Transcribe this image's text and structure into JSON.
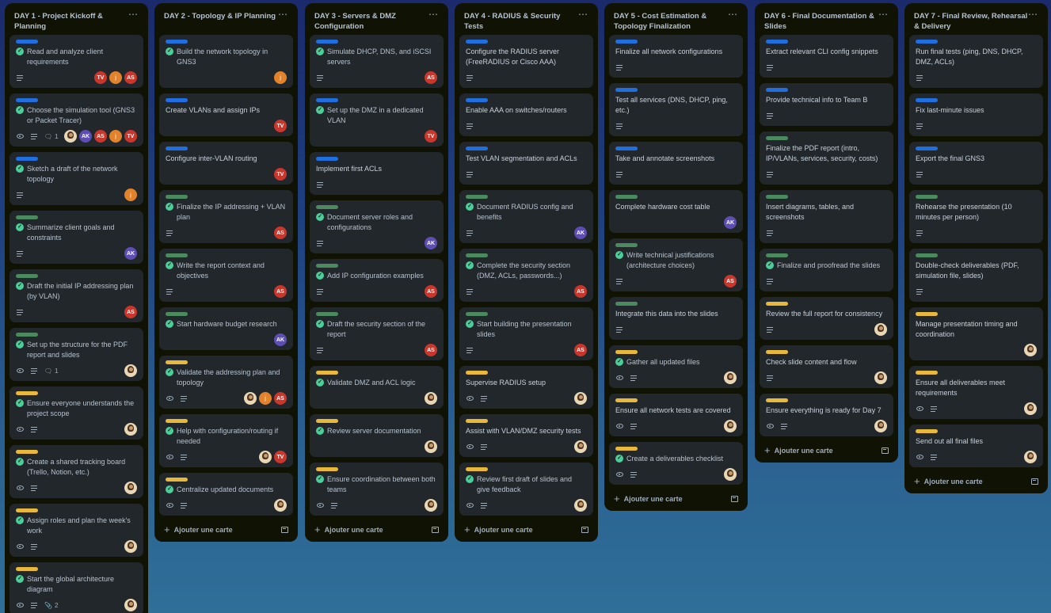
{
  "add_card_label": "Ajouter une carte",
  "lists": [
    {
      "title": "DAY 1 - Project Kickoff & Planning",
      "cards": [
        {
          "label": "blue",
          "done": true,
          "title": "Read and analyze client requirements",
          "watch": false,
          "desc": true,
          "comments": null,
          "attachments": null,
          "members": [
            "TV",
            "J",
            "AS"
          ]
        },
        {
          "label": "blue",
          "done": true,
          "title": "Choose the simulation tool (GNS3 or Packet Tracer)",
          "watch": true,
          "desc": true,
          "comments": "1",
          "attachments": null,
          "members": [
            "P",
            "AK",
            "AS",
            "J",
            "TV"
          ]
        },
        {
          "label": "blue",
          "done": true,
          "title": "Sketch a draft of the network topology",
          "watch": false,
          "desc": true,
          "comments": null,
          "attachments": null,
          "members": [
            "J"
          ]
        },
        {
          "label": "green",
          "done": true,
          "title": "Summarize client goals and constraints",
          "watch": false,
          "desc": true,
          "comments": null,
          "attachments": null,
          "members": [
            "AK"
          ]
        },
        {
          "label": "green",
          "done": true,
          "title": "Draft the initial IP addressing plan (by VLAN)",
          "watch": false,
          "desc": true,
          "comments": null,
          "attachments": null,
          "members": [
            "AS"
          ]
        },
        {
          "label": "green",
          "done": true,
          "title": "Set up the structure for the PDF report and slides",
          "watch": true,
          "desc": true,
          "comments": "1",
          "attachments": null,
          "members": [
            "P"
          ]
        },
        {
          "label": "yellow",
          "done": true,
          "title": "Ensure everyone understands the project scope",
          "watch": true,
          "desc": true,
          "comments": null,
          "attachments": null,
          "members": [
            "P"
          ]
        },
        {
          "label": "yellow",
          "done": true,
          "title": "Create a shared tracking board (Trello, Notion, etc.)",
          "watch": true,
          "desc": true,
          "comments": null,
          "attachments": null,
          "members": [
            "P"
          ]
        },
        {
          "label": "yellow",
          "done": true,
          "title": "Assign roles and plan the week's work",
          "watch": true,
          "desc": true,
          "comments": null,
          "attachments": null,
          "members": [
            "P"
          ]
        },
        {
          "label": "yellow",
          "done": true,
          "title": "Start the global architecture diagram",
          "watch": true,
          "desc": true,
          "comments": null,
          "attachments": "2",
          "members": [
            "P"
          ]
        }
      ]
    },
    {
      "title": "DAY 2 - Topology & IP Planning",
      "cards": [
        {
          "label": "blue",
          "done": true,
          "title": "Build the network topology in GNS3",
          "watch": false,
          "desc": false,
          "comments": null,
          "attachments": null,
          "members": [
            "J"
          ]
        },
        {
          "label": "blue",
          "done": false,
          "title": "Create VLANs and assign IPs",
          "watch": false,
          "desc": false,
          "comments": null,
          "attachments": null,
          "members": [
            "TV"
          ]
        },
        {
          "label": "blue",
          "done": false,
          "title": "Configure inter-VLAN routing",
          "watch": false,
          "desc": false,
          "comments": null,
          "attachments": null,
          "members": [
            "TV"
          ]
        },
        {
          "label": "green",
          "done": true,
          "title": "Finalize the IP addressing + VLAN plan",
          "watch": false,
          "desc": true,
          "comments": null,
          "attachments": null,
          "members": [
            "AS"
          ]
        },
        {
          "label": "green",
          "done": true,
          "title": "Write the report context and objectives",
          "watch": false,
          "desc": true,
          "comments": null,
          "attachments": null,
          "members": [
            "AS"
          ]
        },
        {
          "label": "green",
          "done": true,
          "title": "Start hardware budget research",
          "watch": false,
          "desc": false,
          "comments": null,
          "attachments": null,
          "members": [
            "AK"
          ]
        },
        {
          "label": "yellow",
          "done": true,
          "title": "Validate the addressing plan and topology",
          "watch": true,
          "desc": true,
          "comments": null,
          "attachments": null,
          "members": [
            "P",
            "J",
            "AS"
          ]
        },
        {
          "label": "yellow",
          "done": true,
          "title": "Help with configuration/routing if needed",
          "watch": true,
          "desc": true,
          "comments": null,
          "attachments": null,
          "members": [
            "P",
            "TV"
          ]
        },
        {
          "label": "yellow",
          "done": true,
          "title": "Centralize updated documents",
          "watch": true,
          "desc": true,
          "comments": null,
          "attachments": null,
          "members": [
            "P"
          ]
        }
      ]
    },
    {
      "title": "DAY 3 - Servers & DMZ Configuration",
      "cards": [
        {
          "label": "blue",
          "done": true,
          "title": "Simulate DHCP, DNS, and iSCSI servers",
          "watch": false,
          "desc": true,
          "comments": null,
          "attachments": null,
          "members": [
            "AS"
          ]
        },
        {
          "label": "blue",
          "done": true,
          "title": "Set up the DMZ in a dedicated VLAN",
          "watch": false,
          "desc": false,
          "comments": null,
          "attachments": null,
          "members": [
            "TV"
          ]
        },
        {
          "label": "blue",
          "done": false,
          "title": "Implement first ACLs",
          "watch": false,
          "desc": true,
          "comments": null,
          "attachments": null,
          "members": []
        },
        {
          "label": "green",
          "done": true,
          "title": "Document server roles and configurations",
          "watch": false,
          "desc": true,
          "comments": null,
          "attachments": null,
          "members": [
            "AK"
          ]
        },
        {
          "label": "green",
          "done": true,
          "title": "Add IP configuration examples",
          "watch": false,
          "desc": true,
          "comments": null,
          "attachments": null,
          "members": [
            "AS"
          ]
        },
        {
          "label": "green",
          "done": true,
          "title": "Draft the security section of the report",
          "watch": false,
          "desc": true,
          "comments": null,
          "attachments": null,
          "members": [
            "AS"
          ]
        },
        {
          "label": "yellow",
          "done": true,
          "title": "Validate DMZ and ACL logic",
          "watch": false,
          "desc": false,
          "comments": null,
          "attachments": null,
          "members": [
            "P"
          ]
        },
        {
          "label": "yellow",
          "done": true,
          "title": "Review server documentation",
          "watch": false,
          "desc": false,
          "comments": null,
          "attachments": null,
          "members": [
            "P"
          ]
        },
        {
          "label": "yellow",
          "done": true,
          "title": "Ensure coordination between both teams",
          "watch": true,
          "desc": true,
          "comments": null,
          "attachments": null,
          "members": [
            "P"
          ]
        }
      ]
    },
    {
      "title": "DAY 4 - RADIUS & Security Tests",
      "cards": [
        {
          "label": "blue",
          "done": false,
          "title": "Configure the RADIUS server (FreeRADIUS or Cisco AAA)",
          "watch": false,
          "desc": true,
          "comments": null,
          "attachments": null,
          "members": []
        },
        {
          "label": "blue",
          "done": false,
          "title": "Enable AAA on switches/routers",
          "watch": false,
          "desc": true,
          "comments": null,
          "attachments": null,
          "members": []
        },
        {
          "label": "blue",
          "done": false,
          "title": "Test VLAN segmentation and ACLs",
          "watch": false,
          "desc": true,
          "comments": null,
          "attachments": null,
          "members": []
        },
        {
          "label": "green",
          "done": true,
          "title": "Document RADIUS config and benefits",
          "watch": false,
          "desc": true,
          "comments": null,
          "attachments": null,
          "members": [
            "AK"
          ]
        },
        {
          "label": "green",
          "done": true,
          "title": "Complete the security section (DMZ, ACLs, passwords...)",
          "watch": false,
          "desc": true,
          "comments": null,
          "attachments": null,
          "members": [
            "AS"
          ]
        },
        {
          "label": "green",
          "done": true,
          "title": "Start building the presentation slides",
          "watch": false,
          "desc": true,
          "comments": null,
          "attachments": null,
          "members": [
            "AS"
          ]
        },
        {
          "label": "yellow",
          "done": false,
          "title": "Supervise RADIUS setup",
          "watch": true,
          "desc": true,
          "comments": null,
          "attachments": null,
          "members": [
            "P"
          ]
        },
        {
          "label": "yellow",
          "done": false,
          "title": "Assist with VLAN/DMZ security tests",
          "watch": true,
          "desc": true,
          "comments": null,
          "attachments": null,
          "members": [
            "P"
          ]
        },
        {
          "label": "yellow",
          "done": true,
          "title": "Review first draft of slides and give feedback",
          "watch": true,
          "desc": true,
          "comments": null,
          "attachments": null,
          "members": [
            "P"
          ]
        }
      ]
    },
    {
      "title": "DAY 5 - Cost Estimation & Topology Finalization",
      "cards": [
        {
          "label": "blue",
          "done": false,
          "title": "Finalize all network configurations",
          "watch": false,
          "desc": true,
          "comments": null,
          "attachments": null,
          "members": []
        },
        {
          "label": "blue",
          "done": false,
          "title": "Test all services (DNS, DHCP, ping, etc.)",
          "watch": false,
          "desc": true,
          "comments": null,
          "attachments": null,
          "members": []
        },
        {
          "label": "blue",
          "done": false,
          "title": "Take and annotate screenshots",
          "watch": false,
          "desc": true,
          "comments": null,
          "attachments": null,
          "members": []
        },
        {
          "label": "green",
          "done": false,
          "title": "Complete hardware cost table",
          "watch": false,
          "desc": false,
          "comments": null,
          "attachments": null,
          "members": [
            "AK"
          ]
        },
        {
          "label": "green",
          "done": true,
          "title": "Write technical justifications (architecture choices)",
          "watch": false,
          "desc": true,
          "comments": null,
          "attachments": null,
          "members": [
            "AS"
          ]
        },
        {
          "label": "green",
          "done": false,
          "title": "Integrate this data into the slides",
          "watch": false,
          "desc": true,
          "comments": null,
          "attachments": null,
          "members": []
        },
        {
          "label": "yellow",
          "done": true,
          "title": "Gather all updated files",
          "watch": true,
          "desc": true,
          "comments": null,
          "attachments": null,
          "members": [
            "P"
          ]
        },
        {
          "label": "yellow",
          "done": false,
          "title": "Ensure all network tests are covered",
          "watch": true,
          "desc": true,
          "comments": null,
          "attachments": null,
          "members": [
            "P"
          ]
        },
        {
          "label": "yellow",
          "done": true,
          "title": "Create a deliverables checklist",
          "watch": true,
          "desc": true,
          "comments": null,
          "attachments": null,
          "members": [
            "P"
          ]
        }
      ]
    },
    {
      "title": "DAY 6 - Final Documentation & Slides",
      "cards": [
        {
          "label": "blue",
          "done": false,
          "title": "Extract relevant CLI config snippets",
          "watch": false,
          "desc": true,
          "comments": null,
          "attachments": null,
          "members": []
        },
        {
          "label": "blue",
          "done": false,
          "title": "Provide technical info to Team B",
          "watch": false,
          "desc": true,
          "comments": null,
          "attachments": null,
          "members": []
        },
        {
          "label": "green",
          "done": false,
          "title": "Finalize the PDF report (intro, IP/VLANs, services, security, costs)",
          "watch": false,
          "desc": true,
          "comments": null,
          "attachments": null,
          "members": []
        },
        {
          "label": "green",
          "done": false,
          "title": "Insert diagrams, tables, and screenshots",
          "watch": false,
          "desc": true,
          "comments": null,
          "attachments": null,
          "members": []
        },
        {
          "label": "green",
          "done": true,
          "title": "Finalize and proofread the slides",
          "watch": false,
          "desc": true,
          "comments": null,
          "attachments": null,
          "members": []
        },
        {
          "label": "yellow",
          "done": false,
          "title": "Review the full report for consistency",
          "watch": false,
          "desc": true,
          "comments": null,
          "attachments": null,
          "members": [
            "P"
          ]
        },
        {
          "label": "yellow",
          "done": false,
          "title": "Check slide content and flow",
          "watch": false,
          "desc": true,
          "comments": null,
          "attachments": null,
          "members": [
            "P"
          ]
        },
        {
          "label": "yellow",
          "done": false,
          "title": "Ensure everything is ready for Day 7",
          "watch": true,
          "desc": true,
          "comments": null,
          "attachments": null,
          "members": [
            "P"
          ]
        }
      ]
    },
    {
      "title": "DAY 7 - Final Review, Rehearsal & Delivery",
      "cards": [
        {
          "label": "blue",
          "done": false,
          "title": "Run final tests (ping, DNS, DHCP, DMZ, ACLs)",
          "watch": false,
          "desc": true,
          "comments": null,
          "attachments": null,
          "members": []
        },
        {
          "label": "blue",
          "done": false,
          "title": "Fix last-minute issues",
          "watch": false,
          "desc": true,
          "comments": null,
          "attachments": null,
          "members": []
        },
        {
          "label": "blue",
          "done": false,
          "title": "Export the final GNS3",
          "watch": false,
          "desc": true,
          "comments": null,
          "attachments": null,
          "members": []
        },
        {
          "label": "green",
          "done": false,
          "title": "Rehearse the presentation (10 minutes per person)",
          "watch": false,
          "desc": true,
          "comments": null,
          "attachments": null,
          "members": []
        },
        {
          "label": "green",
          "done": false,
          "title": "Double-check deliverables (PDF, simulation file, slides)",
          "watch": false,
          "desc": true,
          "comments": null,
          "attachments": null,
          "members": []
        },
        {
          "label": "yellow",
          "done": false,
          "title": "Manage presentation timing and coordination",
          "watch": false,
          "desc": false,
          "comments": null,
          "attachments": null,
          "members": [
            "P"
          ]
        },
        {
          "label": "yellow",
          "done": false,
          "title": "Ensure all deliverables meet requirements",
          "watch": true,
          "desc": true,
          "comments": null,
          "attachments": null,
          "members": [
            "P"
          ]
        },
        {
          "label": "yellow",
          "done": false,
          "title": "Send out all final files",
          "watch": true,
          "desc": true,
          "comments": null,
          "attachments": null,
          "members": [
            "P"
          ]
        }
      ]
    }
  ],
  "member_initials": {
    "TV": "TV",
    "J": "j",
    "AS": "AS",
    "AK": "AK",
    "P": ""
  }
}
